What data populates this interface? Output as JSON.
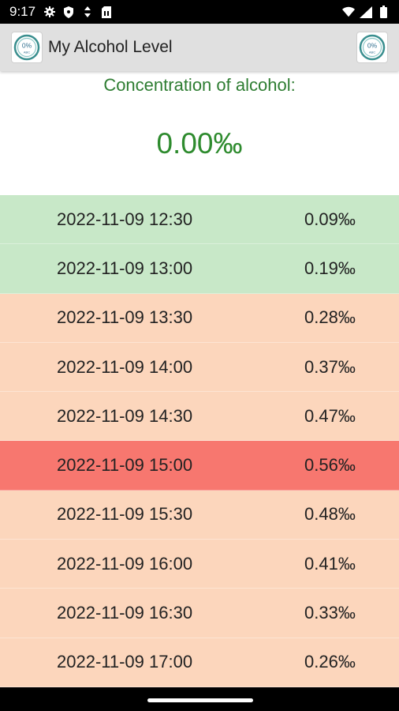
{
  "status_bar": {
    "time": "9:17",
    "icons_left": [
      "gear-icon",
      "shield-icon",
      "data-saver-icon",
      "sim-card-icon"
    ],
    "icons_right": [
      "wifi-icon",
      "signal-icon",
      "battery-icon"
    ]
  },
  "app_bar": {
    "title": "My Alcohol Level",
    "logo_text": "0%",
    "logo_subtext": "ABC",
    "action_icon_text": "0%",
    "action_icon_subtext": "ABC"
  },
  "concentration": {
    "label": "Concentration of alcohol:",
    "value": "0.00‰",
    "color": "#2e8b2e"
  },
  "readings": [
    {
      "time": "2022-11-09 12:30",
      "level": "0.09‰",
      "status": "low"
    },
    {
      "time": "2022-11-09 13:00",
      "level": "0.19‰",
      "status": "low"
    },
    {
      "time": "2022-11-09 13:30",
      "level": "0.28‰",
      "status": "mid"
    },
    {
      "time": "2022-11-09 14:00",
      "level": "0.37‰",
      "status": "mid"
    },
    {
      "time": "2022-11-09 14:30",
      "level": "0.47‰",
      "status": "mid"
    },
    {
      "time": "2022-11-09 15:00",
      "level": "0.56‰",
      "status": "high"
    },
    {
      "time": "2022-11-09 15:30",
      "level": "0.48‰",
      "status": "mid"
    },
    {
      "time": "2022-11-09 16:00",
      "level": "0.41‰",
      "status": "mid"
    },
    {
      "time": "2022-11-09 16:30",
      "level": "0.33‰",
      "status": "mid"
    },
    {
      "time": "2022-11-09 17:00",
      "level": "0.26‰",
      "status": "mid"
    }
  ],
  "status_colors": {
    "low": "#c8e8c8",
    "mid": "#fcd6bc",
    "high": "#f7776f"
  }
}
